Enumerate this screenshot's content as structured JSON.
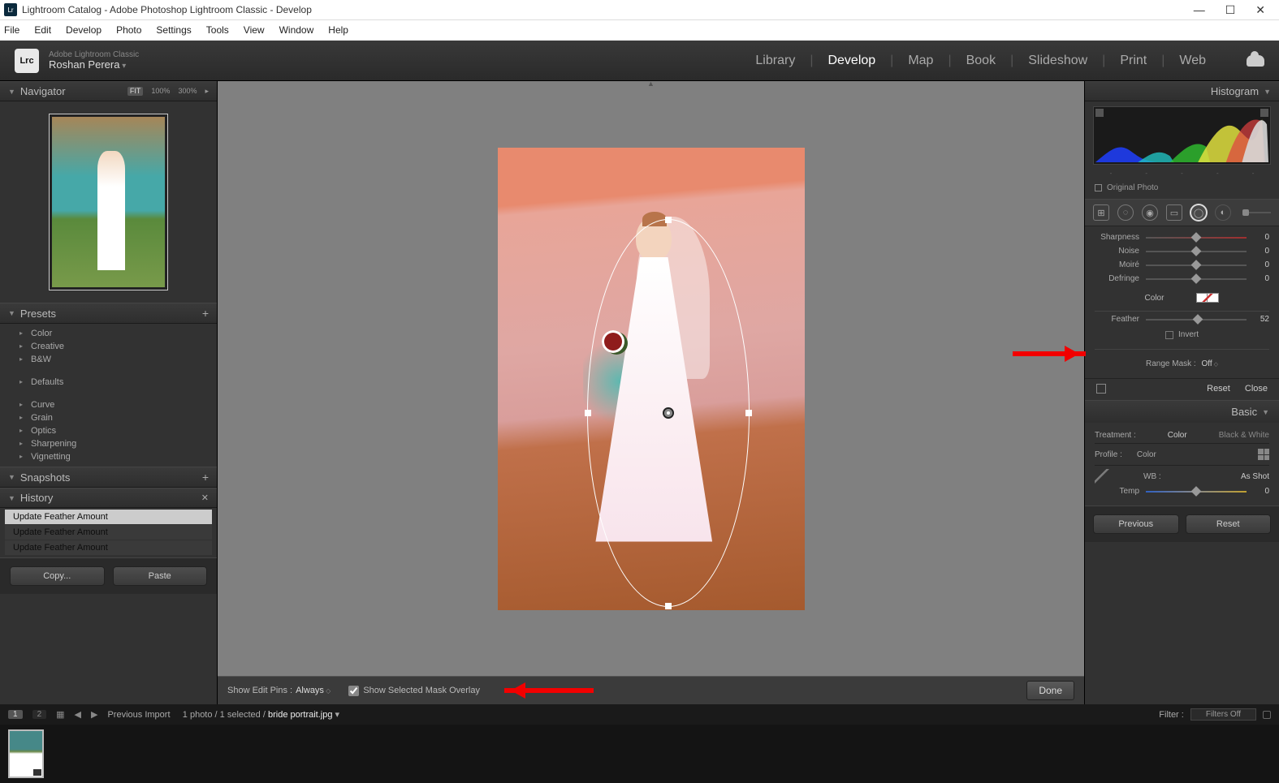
{
  "window": {
    "title": "Lightroom Catalog - Adobe Photoshop Lightroom Classic - Develop",
    "menus": [
      "File",
      "Edit",
      "Develop",
      "Photo",
      "Settings",
      "Tools",
      "View",
      "Window",
      "Help"
    ]
  },
  "header": {
    "badge": "Lrc",
    "product": "Adobe Lightroom Classic",
    "user": "Roshan Perera",
    "modules": [
      "Library",
      "Develop",
      "Map",
      "Book",
      "Slideshow",
      "Print",
      "Web"
    ],
    "active_module": "Develop"
  },
  "navigator": {
    "title": "Navigator",
    "zoom_options": [
      "FIT",
      "100%",
      "300%"
    ],
    "zoom_selected": "FIT"
  },
  "presets": {
    "title": "Presets",
    "groups1": [
      "Color",
      "Creative",
      "B&W"
    ],
    "groups2": [
      "Defaults"
    ],
    "groups3": [
      "Curve",
      "Grain",
      "Optics",
      "Sharpening",
      "Vignetting"
    ]
  },
  "snapshots": {
    "title": "Snapshots"
  },
  "history": {
    "title": "History",
    "items": [
      "Update Feather Amount",
      "Update Feather Amount",
      "Update Feather Amount"
    ]
  },
  "left_buttons": {
    "copy": "Copy...",
    "paste": "Paste"
  },
  "center_bar": {
    "pins_label": "Show Edit Pins :",
    "pins_value": "Always",
    "mask_label": "Show Selected Mask Overlay",
    "mask_checked": true,
    "done": "Done"
  },
  "right": {
    "histogram_title": "Histogram",
    "original_photo": "Original Photo",
    "sliders": [
      {
        "label": "Sharpness",
        "value": 0,
        "pos": 50,
        "grad": true
      },
      {
        "label": "Noise",
        "value": 0,
        "pos": 50
      },
      {
        "label": "Moiré",
        "value": 0,
        "pos": 50
      },
      {
        "label": "Defringe",
        "value": 0,
        "pos": 50
      }
    ],
    "color_label": "Color",
    "feather": {
      "label": "Feather",
      "value": 52,
      "pos": 52
    },
    "invert": "Invert",
    "range_mask_label": "Range Mask :",
    "range_mask_value": "Off",
    "reset": "Reset",
    "close": "Close",
    "basic": {
      "title": "Basic",
      "treatment_label": "Treatment :",
      "treatment_color": "Color",
      "treatment_bw": "Black & White",
      "profile_label": "Profile :",
      "profile_value": "Color",
      "wb_label": "WB :",
      "wb_value": "As Shot",
      "temp_label": "Temp",
      "temp_value": 0
    },
    "prev": "Previous",
    "reset2": "Reset"
  },
  "filmstrip_bar": {
    "pages": [
      "1",
      "2"
    ],
    "prev_folder": "Previous Import",
    "count": "1 photo / 1 selected /",
    "filename": "bride portrait.jpg",
    "filter_label": "Filter :",
    "filter_value": "Filters Off"
  }
}
